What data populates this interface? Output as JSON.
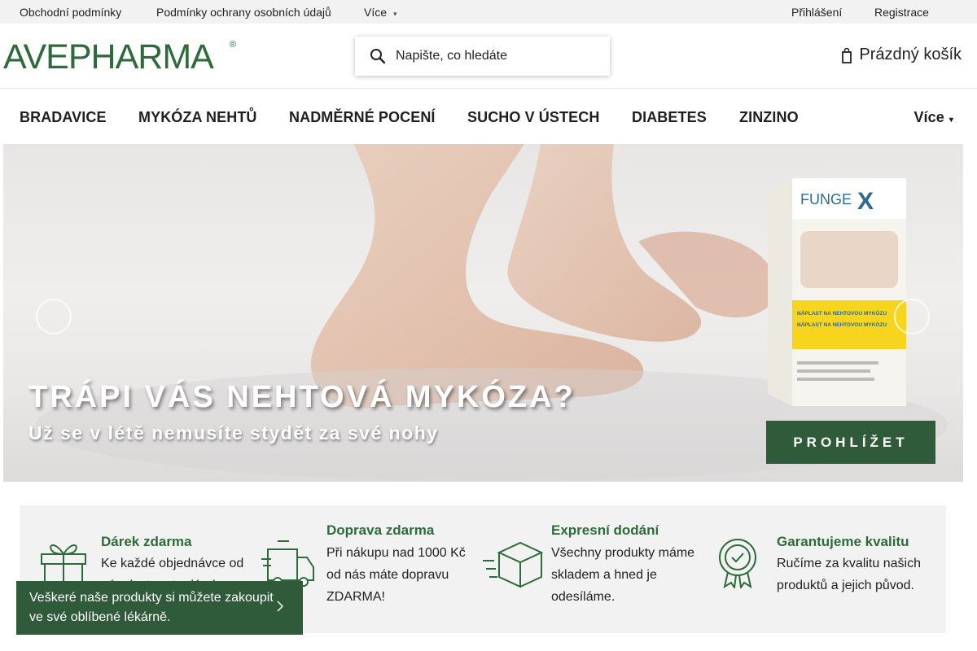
{
  "topbar": {
    "links": [
      "Obchodní podmínky",
      "Podmínky ochrany osobních údajů"
    ],
    "more_label": "Více",
    "login_label": "Přihlášení",
    "register_label": "Registrace"
  },
  "header": {
    "logo_text": "AVEPHARMA",
    "logo_mark": "®",
    "search_placeholder": "Napište, co hledáte",
    "cart_label": "Prázdný košík"
  },
  "categories": {
    "items": [
      "BRADAVICE",
      "MYKÓZA NEHTŮ",
      "NADMĚRNÉ POCENÍ",
      "SUCHO V ÚSTECH",
      "DIABETES",
      "ZINZINO"
    ],
    "more_label": "Více"
  },
  "hero": {
    "headline": "TRÁPI VÁS NEHTOVÁ MYKÓZA?",
    "subline": "Už se v létě nemusíte stydět za své nohy",
    "cta_label": "PROHLÍŽET",
    "product_brand": "FUNGE",
    "product_brand_x": "X",
    "product_line1": "NÁPLAST NA NEHTOVOU MYKÓZU",
    "product_line2": "NÁPLAST NA NEHTOVOU MYKÓZU"
  },
  "benefits": [
    {
      "title": "Dárek zdarma",
      "text": "Ke každé objednávce od nás dostanete dárek.",
      "icon": "gift-icon"
    },
    {
      "title": "Doprava zdarma",
      "text": "Při nákupu nad 1000 Kč od nás máte dopravu ZDARMA!",
      "icon": "truck-icon"
    },
    {
      "title": "Expresní dodání",
      "text": "Všechny produkty máme skladem a hned je odesíláme.",
      "icon": "box-icon"
    },
    {
      "title": "Garantujeme kvalitu",
      "text": "Ručíme za kvalitu našich produktů a jejich původ.",
      "icon": "badge-icon"
    }
  ],
  "toast": {
    "text": "Veškeré naše produkty si můžete zakoupit ve své oblíbené lékárně."
  },
  "colors": {
    "brand_green": "#2e6b3a",
    "cta_green": "#2f5b3a",
    "topbar_bg": "#f2f2f2"
  }
}
